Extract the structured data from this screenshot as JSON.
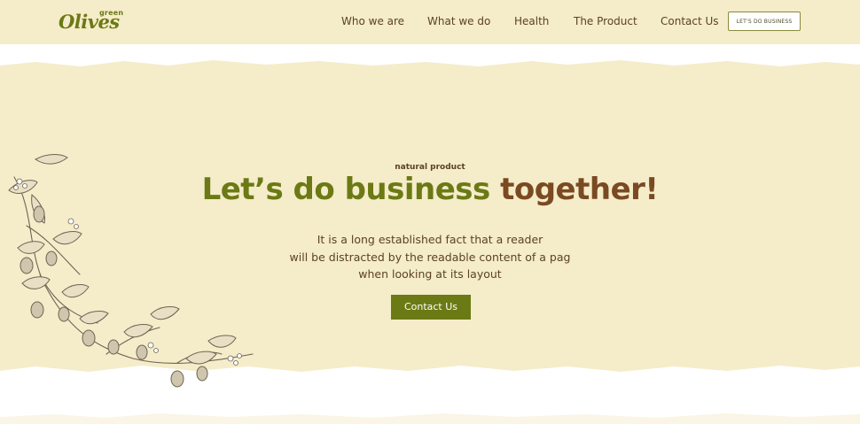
{
  "header": {
    "logo": {
      "small": "green",
      "main": "Olives"
    },
    "nav": [
      {
        "label": "Who we are"
      },
      {
        "label": "What we do"
      },
      {
        "label": "Health"
      },
      {
        "label": "The Product"
      },
      {
        "label": "Contact Us"
      }
    ],
    "cta_label": "LET'S DO BUSINESS"
  },
  "hero": {
    "eyebrow": "natural product",
    "headline_green": "Let’s do business",
    "headline_brown": "together!",
    "description_lines": [
      "It is a long established fact that a reader",
      "will be distracted by the readable content of a pag",
      "when looking at its layout"
    ],
    "cta_label": "Contact Us"
  },
  "colors": {
    "accent_green": "#6b7a14",
    "accent_brown": "#7a4a22",
    "paper": "#f5ecca",
    "text": "#5a4322"
  },
  "icons": {
    "decoration": "olive-branch-illustration"
  }
}
